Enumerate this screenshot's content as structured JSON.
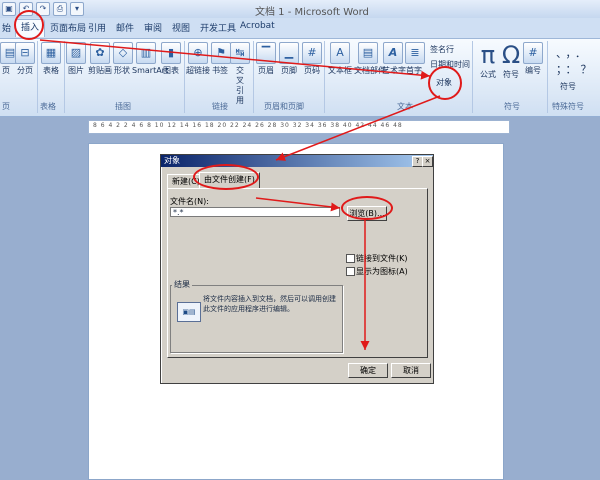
{
  "window": {
    "title": "文档 1 - Microsoft Word"
  },
  "tabs": [
    "插入",
    "页面布局",
    "引用",
    "邮件",
    "审阅",
    "视图",
    "开发工具",
    "Acrobat"
  ],
  "left_cut_tab": "始",
  "ribbon": {
    "items": [
      "页",
      "分页",
      "表格",
      "图片",
      "剪贴画",
      "形状",
      "SmartArt",
      "图表",
      "超链接",
      "书签",
      "交叉引用",
      "页眉",
      "页脚",
      "页码",
      "文本框",
      "文档部件",
      "艺术字",
      "首字",
      "公式",
      "符号",
      "编号"
    ],
    "small_items": [
      "签名行",
      "日期和时间",
      "对象",
      "符号"
    ],
    "groups": [
      "页",
      "表格",
      "插图",
      "链接",
      "页眉和页脚",
      "文本",
      "符号",
      "特殊符号"
    ]
  },
  "ruler": {
    "text": "8 6 4 2   2 4 6 8 10 12 14 16 18 20 22 24 26 28 30 32 34 36 38 40 42 44 46 48"
  },
  "dialog": {
    "title": "对象",
    "help": "?",
    "close": "×",
    "tabs": [
      "新建(C)",
      "由文件创建(F)"
    ],
    "filename_label": "文件名(N):",
    "filename_value": "*.*",
    "browse": "浏览(B)...",
    "link_checkbox": "链接到文件(K)",
    "icon_checkbox": "显示为图标(A)",
    "result_label": "结果",
    "result_text": "将文件内容插入到文档，然后可以调用创建此文件的应用程序进行编辑。",
    "ok": "确定",
    "cancel": "取消"
  },
  "icons": [
    "save-icon",
    "undo-icon",
    "redo-icon",
    "print-icon",
    "customize-icon",
    "pi-icon",
    "omega-icon"
  ],
  "annotation_color": "#e01a1a"
}
